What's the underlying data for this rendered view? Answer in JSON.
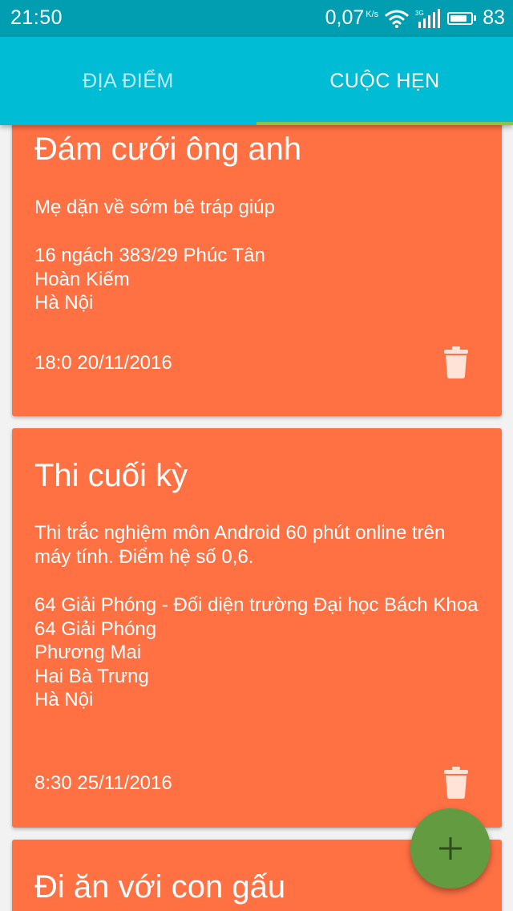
{
  "status_bar": {
    "time": "21:50",
    "net_speed": "0,07",
    "net_speed_unit": "K/s",
    "network_type": "3G",
    "battery_level": "83",
    "battery_fraction": 0.83
  },
  "tabs": [
    {
      "label": "ĐỊA ĐIỂM",
      "selected": false
    },
    {
      "label": "CUỘC HẸN",
      "selected": true
    }
  ],
  "colors": {
    "status_bar": "#009eb0",
    "app_bar": "#00bcd4",
    "tab_indicator": "#8bc34a",
    "card": "#ff7043",
    "fab": "#629b40",
    "background": "#f2f2f2"
  },
  "icons": {
    "wifi": "wifi-icon",
    "signal": "signal-icon",
    "battery": "battery-icon",
    "delete": "trash-icon",
    "add": "plus-icon"
  },
  "appointments": [
    {
      "title": "Đám cưới ông anh",
      "description": "Mẹ dặn về sớm bê tráp giúp",
      "address_lines": [
        "16 ngách 383/29 Phúc Tân",
        "Hoàn Kiếm",
        "Hà Nội"
      ],
      "datetime": "18:0 20/11/2016"
    },
    {
      "title": "Thi cuối kỳ",
      "description": "Thi trắc nghiệm môn Android 60 phút online trên máy tính. Điểm hệ số 0,6.",
      "address_lines": [
        "64 Giải Phóng - Đối diện trường Đại học Bách Khoa",
        "64 Giải Phóng",
        "Phương Mai",
        "Hai Bà Trưng",
        "Hà Nội"
      ],
      "datetime": "8:30 25/11/2016"
    },
    {
      "title": "Đi ăn với con gấu"
    }
  ]
}
